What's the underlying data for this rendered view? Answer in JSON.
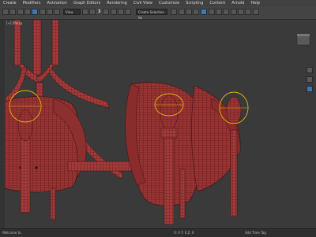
{
  "menu": [
    "Create",
    "Modifiers",
    "Animation",
    "Graph Editors",
    "Rendering",
    "Civil View",
    "Customize",
    "Scripting",
    "Content",
    "Arnold",
    "Help"
  ],
  "toolbar": {
    "view_dropdown": "View",
    "snap_value": "3",
    "selection_set_placeholder": "Create Selection Se"
  },
  "viewport": {
    "label": "[+] [Persp",
    "colors": {
      "background": "#3a3a3a",
      "mesh_fill": "#a23a3a",
      "mesh_line": "#4a1616",
      "gizmo": "#e8b400"
    }
  },
  "status": {
    "left": "Welcome to",
    "center": "Add Time Tag",
    "coords": "X: 0  Y: 0  Z: 0"
  },
  "icons": [
    "undo-icon",
    "redo-icon",
    "link-icon",
    "unlink-icon",
    "select-icon",
    "move-icon",
    "rotate-icon",
    "scale-icon",
    "snap-icon",
    "mirror-icon",
    "align-icon",
    "render-icon",
    "viewcube-icon",
    "nav-pan-icon",
    "nav-orbit-icon",
    "nav-zoom-icon"
  ]
}
